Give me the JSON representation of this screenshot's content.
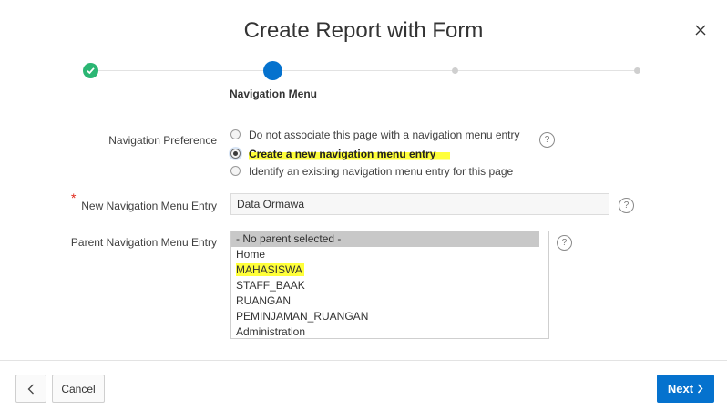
{
  "dialog": {
    "title": "Create Report with Form",
    "close_icon": "close-icon"
  },
  "wizard": {
    "current_step_label": "Navigation Menu",
    "steps": [
      {
        "state": "completed",
        "color": "#2bb673"
      },
      {
        "state": "current",
        "color": "#0572ce"
      },
      {
        "state": "future",
        "color": "#cfcfcf"
      },
      {
        "state": "future",
        "color": "#cfcfcf"
      }
    ]
  },
  "form": {
    "navigation_preference": {
      "label": "Navigation Preference",
      "options": [
        {
          "label": "Do not associate this page with a navigation menu entry",
          "checked": false
        },
        {
          "label": "Create a new navigation menu entry",
          "checked": true,
          "highlighted": true
        },
        {
          "label": "Identify an existing navigation menu entry for this page",
          "checked": false
        }
      ]
    },
    "new_menu_entry": {
      "required_marker": "*",
      "label": "New Navigation Menu Entry",
      "value": "Data Ormawa"
    },
    "parent_menu_entry": {
      "label": "Parent Navigation Menu Entry",
      "options": [
        {
          "label": "- No parent selected -",
          "selected": true
        },
        {
          "label": "Home"
        },
        {
          "label": "MAHASISWA",
          "highlighted": true
        },
        {
          "label": "STAFF_BAAK"
        },
        {
          "label": "RUANGAN"
        },
        {
          "label": "PEMINJAMAN_RUANGAN"
        },
        {
          "label": "Administration"
        }
      ]
    },
    "help_icon_text": "?"
  },
  "footer": {
    "previous_icon": "chevron-left-icon",
    "cancel_label": "Cancel",
    "next_label": "Next",
    "next_icon": "chevron-right-icon"
  },
  "colors": {
    "accent": "#0572ce",
    "success": "#2bb673",
    "highlight": "#ffff3a",
    "required": "#e0281a"
  }
}
